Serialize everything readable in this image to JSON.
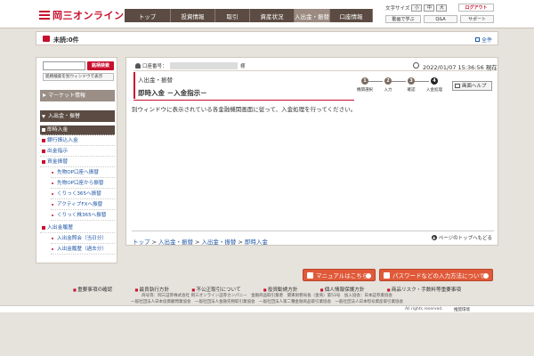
{
  "header": {
    "logo_text": "岡三オンライン",
    "nav": [
      {
        "label": "トップ",
        "w": 52
      },
      {
        "label": "投資情報",
        "w": 50
      },
      {
        "label": "取引",
        "w": 39
      },
      {
        "label": "資産状況",
        "w": 50
      },
      {
        "label": "入出金・振替",
        "w": 40
      },
      {
        "label": "口座情報",
        "w": 48
      }
    ],
    "font_size_label": "文字サイズ",
    "font_sizes": [
      "小",
      "中",
      "大"
    ],
    "logout": "ログアウト",
    "learn": "動画で学ぶ",
    "qa": "Q&A",
    "support": "サポート"
  },
  "notice": {
    "unread": "未読:0件",
    "all": "全件"
  },
  "sidebar": {
    "search_button": "銘柄検索",
    "window_button": "銘柄検索を別ウィンドウで表示",
    "market_info": "マーケット情報",
    "deposit_section": "入出金・振替",
    "items": {
      "immediate": "即時入金",
      "bank_transfer": "銀行振込入金",
      "withdraw": "出金指示",
      "fund_transfer": "資金振替",
      "to_futures": "先物OP口座へ振替",
      "from_futures": "先物OP口座から振替",
      "kurikku365_to": "くりっく365へ振替",
      "active_fx": "アクティブFXへ振替",
      "kabu365": "くりっく株365へ振替",
      "history": "入出金履歴",
      "history_today": "入出金照会（当日分）",
      "history_past": "入出金履歴（過去分）"
    }
  },
  "main": {
    "account_label": "口座番号：",
    "sama": "様",
    "datetime": "2022/01/07 15:36:56 現在",
    "crumb_title": "入出金・振替",
    "page_title": "即時入金 －入金指示－",
    "steps": [
      {
        "num": "1",
        "label": "機関選択"
      },
      {
        "num": "2",
        "label": "入力"
      },
      {
        "num": "3",
        "label": "確認"
      },
      {
        "num": "4",
        "label": "入金処理"
      }
    ],
    "help": "画面ヘルプ",
    "message": "別ウィンドウに表示されている各金融機関画面に従って、入金処理を行ってください。",
    "breadcrumb": [
      "トップ",
      "入出金・振替",
      "入出金・振替",
      "即時入金"
    ],
    "page_top": "ページのトップへもどる"
  },
  "footer": {
    "manual": "マニュアルはこちら",
    "password": "パスワードなどの入力方法について",
    "links": [
      "重要事項の確認",
      "最良執行方針",
      "不公正取引について",
      "投資勧誘方針",
      "個人情報保護方針",
      "商品リスク・手数料等重要事項"
    ],
    "line1": "商号等：岡三証券株式会社 岡三オンライン証券カンパニー　金融商品取引業者　関東財務局長（金商）第53号　加入協会：日本証券業協会",
    "line2": "一般社団法人日本投資顧問業協会　一般社団法人金融先物取引業協会　一般社団法人第二種金融商品取引業協会　一般社団法人日本暗号資産取引業協会",
    "rights": "All rights reserved.",
    "recommend": "推奨環境"
  }
}
